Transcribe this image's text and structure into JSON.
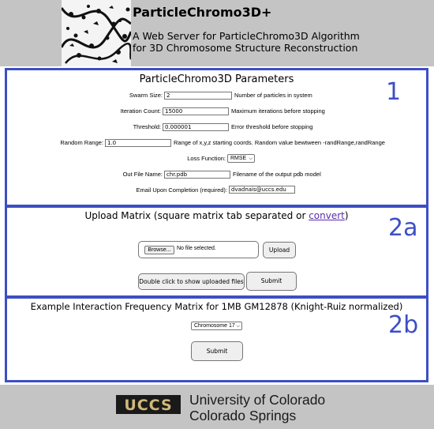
{
  "header": {
    "title": "ParticleChromo3D+",
    "subtitle_line1": "A Web Server for ParticleChromo3D Algorithm",
    "subtitle_line2": "for 3D Chromosome Structure Reconstruction"
  },
  "panel1": {
    "number": "1",
    "title": "ParticleChromo3D Parameters",
    "fields": [
      {
        "label": "Swarm Size:",
        "value": "2",
        "desc": "Number of particles in system"
      },
      {
        "label": "Iteration Count:",
        "value": "15000",
        "desc": "Maximum iterations before stopping"
      },
      {
        "label": "Threshold:",
        "value": "0.000001",
        "desc": "Error threshold before stopping"
      },
      {
        "label": "Random Range:",
        "value": "1.0",
        "desc": "Range of x,y,z starting coords. Random value bewtween -randRange,randRange"
      },
      {
        "label": "Out File Name:",
        "value": "chr.pdb",
        "desc": "Filename of the output pdb model"
      },
      {
        "label": "Email Upon Completion (required):",
        "value": "dvadnais@uccs.edu",
        "desc": ""
      }
    ],
    "loss_label": "Loss Function:",
    "loss_value": "RMSE"
  },
  "panel2": {
    "number": "2a",
    "title_prefix": "Upload Matrix (square matrix tab separated or ",
    "title_link": "convert",
    "title_suffix": ")",
    "browse_label": "Browse...",
    "file_status": "No file selected.",
    "upload_label": "Upload",
    "show_label": "Double click to show uploaded files",
    "submit_label": "Submit"
  },
  "panel3": {
    "number": "2b",
    "title": "Example Interaction Frequency Matrix for 1MB GM12878 (Knight-Ruiz normalized)",
    "chromosome_value": "Chromosome 17",
    "submit_label": "Submit"
  },
  "footer": {
    "logo_text": "UCCS",
    "line1": "University of Colorado",
    "line2": "Colorado Springs"
  }
}
